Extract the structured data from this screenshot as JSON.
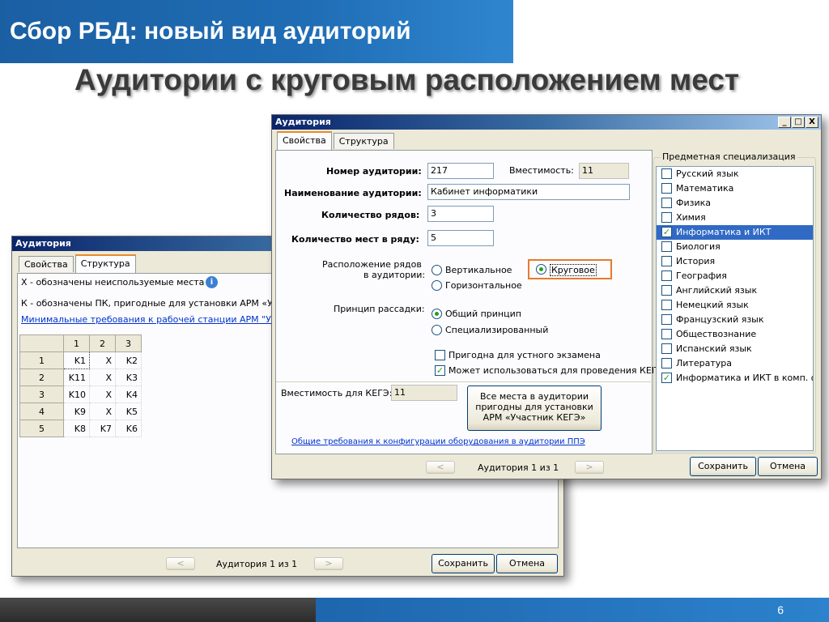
{
  "slide": {
    "header": "Сбор РБД: новый вид аудиторий",
    "title": "Аудитории с круговым расположением мест",
    "page_number": "6"
  },
  "back_window": {
    "title": "Аудитория",
    "tabs": [
      "Свойства",
      "Структура"
    ],
    "active_tab": 1,
    "note_unused": "X - обозначены неиспользуемые места",
    "note_pk": "К - обозначены ПК, пригодные для установки АРМ «Учас",
    "link": "Минимальные требования к рабочей станции АРМ \"Учас",
    "grid": {
      "columns": [
        "1",
        "2",
        "3"
      ],
      "rows": [
        {
          "label": "1",
          "cells": [
            "K1",
            "X",
            "K2"
          ]
        },
        {
          "label": "2",
          "cells": [
            "K11",
            "X",
            "K3"
          ]
        },
        {
          "label": "3",
          "cells": [
            "K10",
            "X",
            "K4"
          ]
        },
        {
          "label": "4",
          "cells": [
            "K9",
            "X",
            "K5"
          ]
        },
        {
          "label": "5",
          "cells": [
            "K8",
            "K7",
            "K6"
          ]
        }
      ]
    },
    "nav_prev": "<",
    "nav_text": "Аудитория 1 из 1",
    "nav_next": ">",
    "save": "Сохранить",
    "cancel": "Отмена"
  },
  "front_window": {
    "title": "Аудитория",
    "controls": {
      "min": "_",
      "max": "□",
      "close": "X"
    },
    "tabs": [
      "Свойства",
      "Структура"
    ],
    "active_tab": 0,
    "room_number_label": "Номер аудитории:",
    "room_number": "217",
    "capacity_label": "Вместимость:",
    "capacity": "11",
    "room_name_label": "Наименование аудитории:",
    "room_name": "Кабинет информатики",
    "rows_label": "Количество рядов:",
    "rows": "3",
    "seats_label": "Количество мест в ряду:",
    "seats": "5",
    "arrangement_label_1": "Расположение рядов",
    "arrangement_label_2": "в аудитории:",
    "arr_vertical": "Вертикальное",
    "arr_circular": "Круговое",
    "arr_horizontal": "Горизонтальное",
    "seating_label": "Принцип рассадки:",
    "seat_general": "Общий принцип",
    "seat_special": "Специализированный",
    "oral_exam": "Пригодна для устного экзамена",
    "kege": "Может использоваться для проведения КЕГЭ",
    "kege_capacity_label": "Вместимость для КЕГЭ:",
    "kege_capacity": "11",
    "all_seats_button": [
      "Все места в аудитории",
      "пригодны для установки",
      "АРМ «Участник КЕГЭ»"
    ],
    "requirements_link": "Общие требования к конфигурации оборудования в аудитории ППЭ",
    "nav_prev": "<",
    "nav_text": "Аудитория 1 из 1",
    "nav_next": ">",
    "save": "Сохранить",
    "cancel": "Отмена",
    "spec_title": "Предметная специализация",
    "subjects": [
      {
        "name": "Русский язык",
        "checked": false
      },
      {
        "name": "Математика",
        "checked": false
      },
      {
        "name": "Физика",
        "checked": false
      },
      {
        "name": "Химия",
        "checked": false
      },
      {
        "name": "Информатика и ИКТ",
        "checked": true
      },
      {
        "name": "Биология",
        "checked": false
      },
      {
        "name": "История",
        "checked": false
      },
      {
        "name": "География",
        "checked": false
      },
      {
        "name": "Английский язык",
        "checked": false
      },
      {
        "name": "Немецкий язык",
        "checked": false
      },
      {
        "name": "Французский язык",
        "checked": false
      },
      {
        "name": "Обществознание",
        "checked": false
      },
      {
        "name": "Испанский язык",
        "checked": false
      },
      {
        "name": "Литература",
        "checked": false
      },
      {
        "name": "Информатика и ИКТ в комп. фо",
        "checked": true
      }
    ],
    "selected_subject_index": 4
  },
  "colors": {
    "header_blue": "#1f6db5",
    "highlight_orange": "#e67a2e",
    "selection_blue": "#316ac5"
  }
}
